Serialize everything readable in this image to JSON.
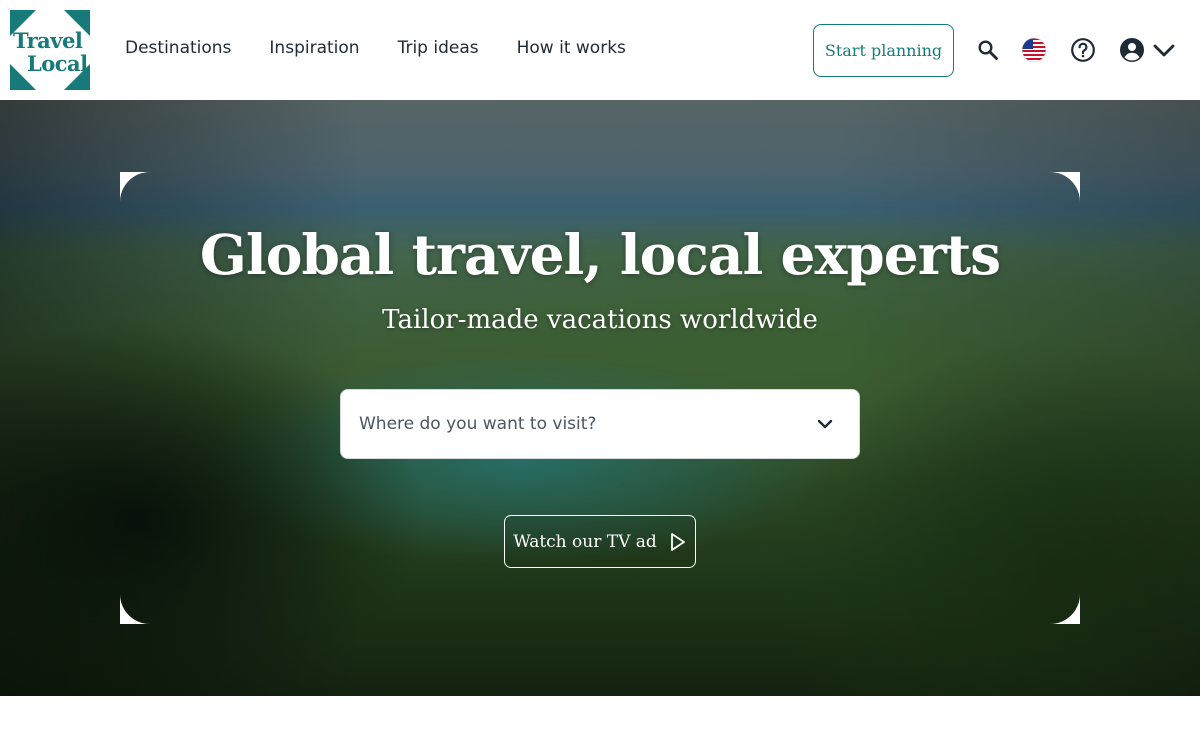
{
  "logo": {
    "line1": "Travel",
    "line2": "Local"
  },
  "nav": {
    "items": [
      {
        "label": "Destinations"
      },
      {
        "label": "Inspiration"
      },
      {
        "label": "Trip ideas"
      },
      {
        "label": "How it works"
      }
    ]
  },
  "header": {
    "start_planning": "Start planning",
    "icons": [
      "search-icon",
      "us-flag-icon",
      "help-icon",
      "account-icon",
      "chevron-down-icon"
    ]
  },
  "hero": {
    "title": "Global travel, local experts",
    "subtitle": "Tailor-made vacations worldwide",
    "destination_placeholder": "Where do you want to visit?",
    "tv_ad_label": "Watch our TV ad"
  },
  "colors": {
    "brand_teal": "#177a7a",
    "text_dark": "#1f2a37",
    "white": "#ffffff"
  }
}
